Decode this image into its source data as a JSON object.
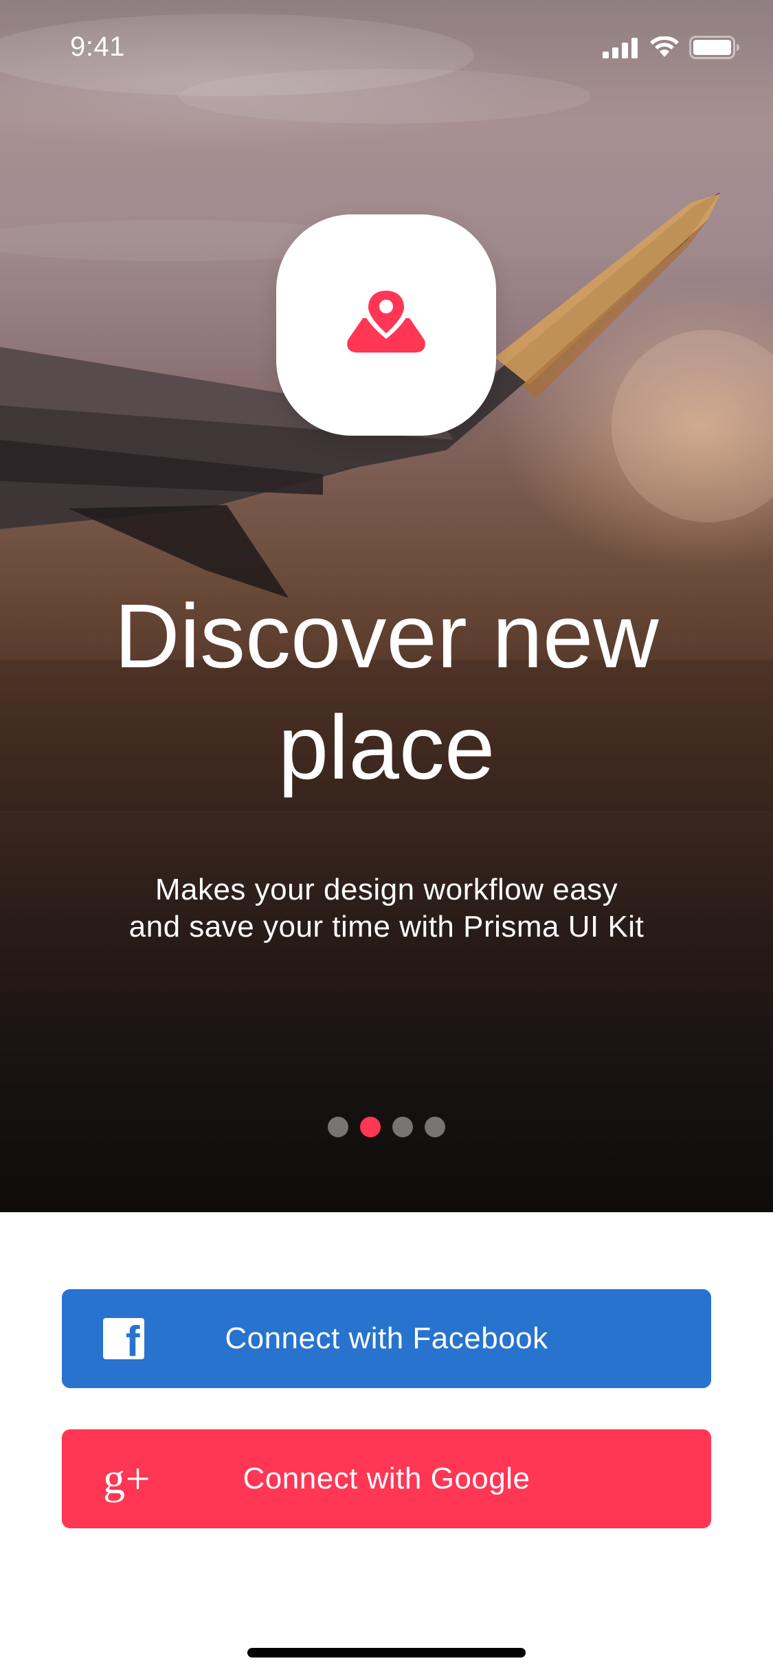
{
  "status_bar": {
    "time": "9:41"
  },
  "hero": {
    "title": "Discover new place",
    "subtitle_line1": "Makes your design workflow easy",
    "subtitle_line2": "and save your time with Prisma UI Kit",
    "app_icon": "map-pin-icon",
    "pager": {
      "total": 4,
      "active_index": 1
    }
  },
  "buttons": {
    "facebook": {
      "label": "Connect with Facebook",
      "icon": "facebook-icon"
    },
    "google": {
      "label": "Connect with Google",
      "icon": "google-plus-icon"
    }
  },
  "colors": {
    "accent": "#ff3654",
    "facebook": "#2873cd",
    "google": "#ff3654",
    "background": "#ffffff"
  }
}
